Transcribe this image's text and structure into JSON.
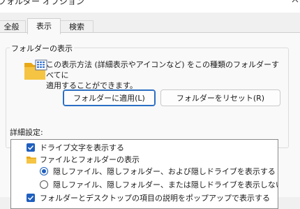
{
  "window": {
    "title": "フォルダー オプション",
    "close_icon": "close-icon"
  },
  "tabs": [
    {
      "label": "全般",
      "active": false
    },
    {
      "label": "表示",
      "active": true
    },
    {
      "label": "検索",
      "active": false
    }
  ],
  "folder_views": {
    "group_label": "フォルダーの表示",
    "icon": "folder-view-icon",
    "description_line1": "この表示方法 (詳細表示やアイコンなど) をこの種類のフォルダーすべてに",
    "description_line2": "適用することができます。",
    "apply_button": "フォルダーに適用(L)",
    "reset_button": "フォルダーをリセット(R)"
  },
  "advanced": {
    "label": "詳細設定:",
    "items": [
      {
        "type": "checkbox",
        "checked": true,
        "label": "ドライブ文字を表示する"
      },
      {
        "type": "folder",
        "label": "ファイルとフォルダーの表示"
      },
      {
        "type": "radio",
        "selected": true,
        "label": "隠しファイル、隠しフォルダー、および隠しドライブを表示する"
      },
      {
        "type": "radio",
        "selected": false,
        "label": "隠しファイル、隠しフォルダー、または隠しドライブを表示しない"
      },
      {
        "type": "checkbox",
        "checked": true,
        "label": "フォルダーとデスクトップの項目の説明をポップアップで表示する"
      }
    ]
  },
  "colors": {
    "accent": "#1f5fbf",
    "window_bg": "#f0f0f0",
    "panel_bg": "#f9f9f9"
  }
}
